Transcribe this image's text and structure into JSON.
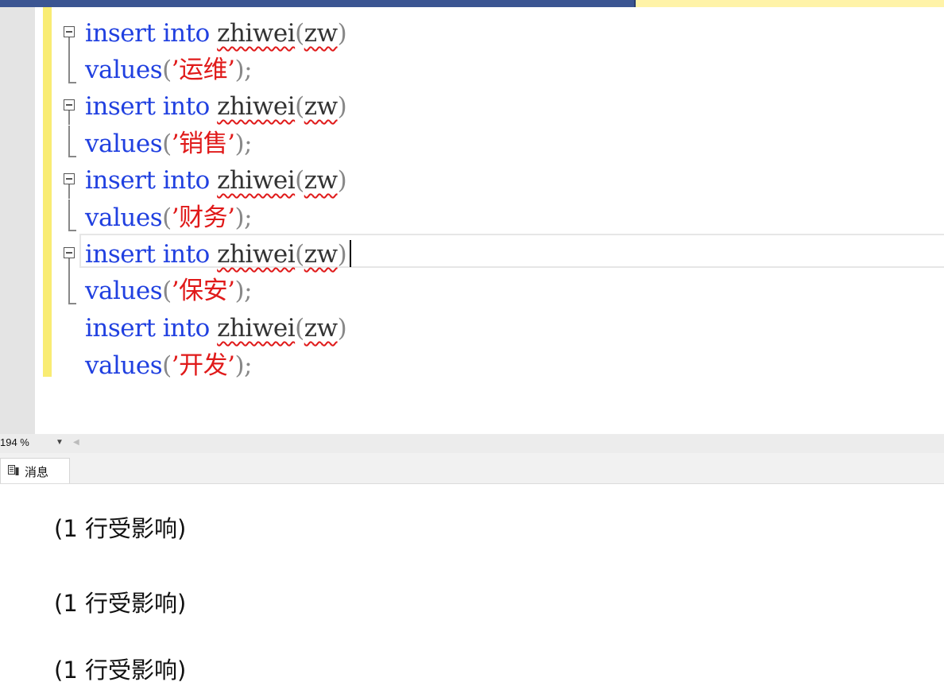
{
  "tabs": [
    {
      "label": "",
      "active": false
    },
    {
      "label": "",
      "active": true
    }
  ],
  "editor": {
    "lines": [
      {
        "kw": "insert into",
        "table": "zhiwei",
        "col": "zw",
        "kind": "insert",
        "fold": true
      },
      {
        "kw": "values",
        "value": "运维",
        "kind": "values"
      },
      {
        "kw": "insert into",
        "table": "zhiwei",
        "col": "zw",
        "kind": "insert",
        "fold": true
      },
      {
        "kw": "values",
        "value": "销售",
        "kind": "values"
      },
      {
        "kw": "insert into",
        "table": "zhiwei",
        "col": "zw",
        "kind": "insert",
        "fold": true
      },
      {
        "kw": "values",
        "value": "财务",
        "kind": "values"
      },
      {
        "kw": "insert into",
        "table": "zhiwei",
        "col": "zw",
        "kind": "insert",
        "fold": true,
        "cursor": true
      },
      {
        "kw": "values",
        "value": "保安",
        "kind": "values"
      },
      {
        "kw": "insert into",
        "table": "zhiwei",
        "col": "zw",
        "kind": "insert",
        "fold": false
      },
      {
        "kw": "values",
        "value": "开发",
        "kind": "values"
      }
    ]
  },
  "zoom": {
    "value": "194 %"
  },
  "results": {
    "tab_label": "消息",
    "messages": [
      "(1 行受影响)",
      "(1 行受影响)",
      "(1 行受影响)"
    ]
  },
  "colors": {
    "keyword": "#2040e0",
    "string": "#e01a1a",
    "change_bar": "#f9ec73"
  }
}
